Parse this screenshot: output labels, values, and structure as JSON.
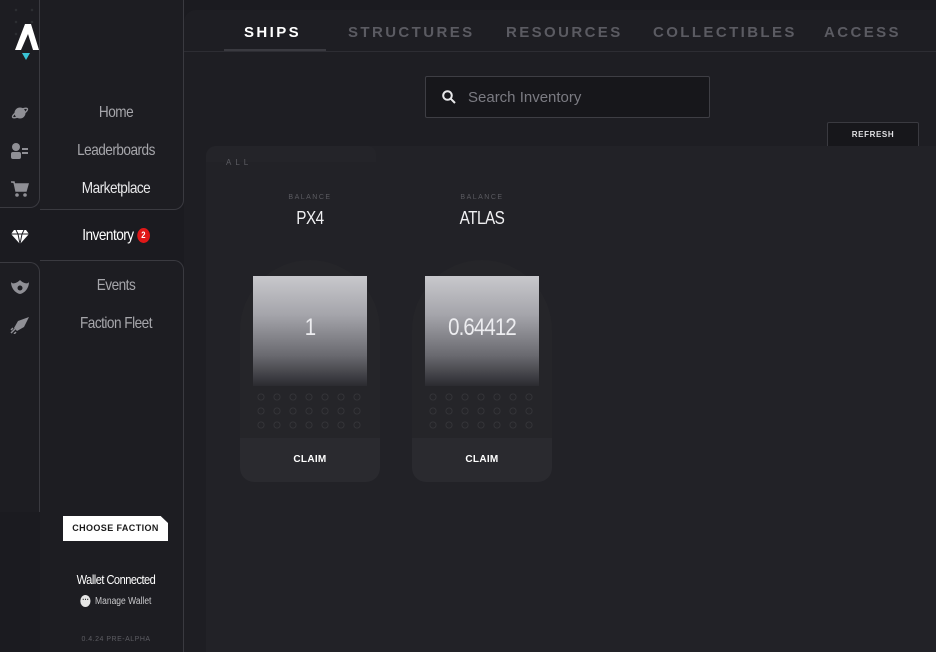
{
  "nav": {
    "items": [
      {
        "label": "Home",
        "icon": "planet-icon"
      },
      {
        "label": "Leaderboards",
        "icon": "crew-icon"
      },
      {
        "label": "Marketplace",
        "icon": "cart-icon"
      },
      {
        "label": "Inventory",
        "icon": "diamond-icon",
        "badge": "2"
      },
      {
        "label": "Events",
        "icon": "phoenix-icon"
      },
      {
        "label": "Faction Fleet",
        "icon": "rocket-icon"
      }
    ],
    "choose_faction": "CHOOSE FACTION",
    "wallet_status": "Wallet Connected",
    "manage_wallet": "Manage Wallet",
    "version": "0.4.24 PRE-ALPHA"
  },
  "tabs": [
    "SHIPS",
    "STRUCTURES",
    "RESOURCES",
    "COLLECTIBLES",
    "ACCESS"
  ],
  "search": {
    "placeholder": "Search Inventory"
  },
  "refresh_label": "REFRESH",
  "filter_label": "ALL",
  "balances": [
    {
      "label": "BALANCE",
      "name": "PX4",
      "value": "1",
      "claim": "CLAIM"
    },
    {
      "label": "BALANCE",
      "name": "ATLAS",
      "value": "0.64412",
      "claim": "CLAIM"
    }
  ],
  "colors": {
    "background": "#1b1b20",
    "accent_logo": "#3ac4d6",
    "badge": "#e01818",
    "active_tab": "#ffffff",
    "inactive_tab": "#5b5b62"
  }
}
